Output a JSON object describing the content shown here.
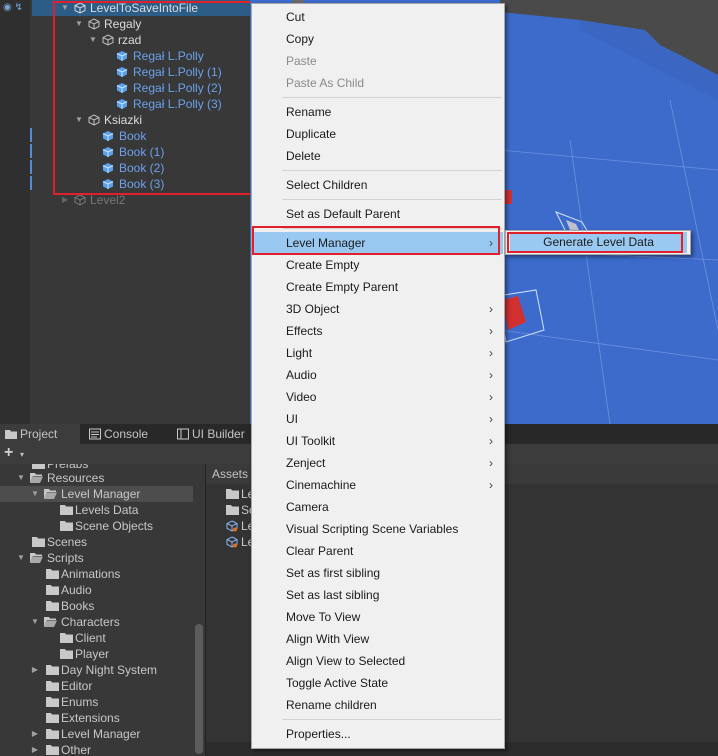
{
  "hierarchy": {
    "root": "LevelToSaveIntoFile",
    "items": [
      {
        "label": "Regaly"
      },
      {
        "label": "rzad"
      },
      {
        "label": "Regał L.Polly"
      },
      {
        "label": "Regał L.Polly (1)"
      },
      {
        "label": "Regał L.Polly (2)"
      },
      {
        "label": "Regał L.Polly (3)"
      },
      {
        "label": "Ksiazki"
      },
      {
        "label": "Book"
      },
      {
        "label": "Book (1)"
      },
      {
        "label": "Book (2)"
      },
      {
        "label": "Book (3)"
      },
      {
        "label": "Level2"
      }
    ]
  },
  "tabs": [
    {
      "label": "Project",
      "icon": "folder-icon"
    },
    {
      "label": "Console",
      "icon": "console-icon"
    },
    {
      "label": "UI Builder",
      "icon": "ui-builder-icon"
    }
  ],
  "toolbar": {
    "add_label": "+",
    "add_caret": "▾"
  },
  "project_tree": [
    {
      "label": "Prefabs"
    },
    {
      "label": "Resources"
    },
    {
      "label": "Level Manager"
    },
    {
      "label": "Levels Data"
    },
    {
      "label": "Scene Objects"
    },
    {
      "label": "Scenes"
    },
    {
      "label": "Scripts"
    },
    {
      "label": "Animations"
    },
    {
      "label": "Audio"
    },
    {
      "label": "Books"
    },
    {
      "label": "Characters"
    },
    {
      "label": "Client"
    },
    {
      "label": "Player"
    },
    {
      "label": "Day Night System"
    },
    {
      "label": "Editor"
    },
    {
      "label": "Enums"
    },
    {
      "label": "Extensions"
    },
    {
      "label": "Level Manager"
    },
    {
      "label": "Other"
    }
  ],
  "assets": {
    "header": "Assets",
    "items": [
      {
        "label": "Le"
      },
      {
        "label": "Sc"
      },
      {
        "label": "Le"
      },
      {
        "label": "Le"
      }
    ]
  },
  "context_menu": {
    "items": [
      {
        "label": "Cut"
      },
      {
        "label": "Copy"
      },
      {
        "label": "Paste"
      },
      {
        "label": "Paste As Child"
      },
      {
        "label": "Rename"
      },
      {
        "label": "Duplicate"
      },
      {
        "label": "Delete"
      },
      {
        "label": "Select Children"
      },
      {
        "label": "Set as Default Parent"
      },
      {
        "label": "Level Manager"
      },
      {
        "label": "Create Empty"
      },
      {
        "label": "Create Empty Parent"
      },
      {
        "label": "3D Object"
      },
      {
        "label": "Effects"
      },
      {
        "label": "Light"
      },
      {
        "label": "Audio"
      },
      {
        "label": "Video"
      },
      {
        "label": "UI"
      },
      {
        "label": "UI Toolkit"
      },
      {
        "label": "Zenject"
      },
      {
        "label": "Cinemachine"
      },
      {
        "label": "Camera"
      },
      {
        "label": "Visual Scripting Scene Variables"
      },
      {
        "label": "Clear Parent"
      },
      {
        "label": "Set as first sibling"
      },
      {
        "label": "Set as last sibling"
      },
      {
        "label": "Move To View"
      },
      {
        "label": "Align With View"
      },
      {
        "label": "Align View to Selected"
      },
      {
        "label": "Toggle Active State"
      },
      {
        "label": "Rename children"
      },
      {
        "label": "Properties..."
      }
    ],
    "submenu_arrow": "›",
    "submenu": {
      "label": "Generate Level Data"
    }
  },
  "colors": {
    "selection": "#2c5d87",
    "menu_highlight": "#99c9f1",
    "annotation_red": "#e0202a",
    "scene_blue": "#3c68c8",
    "prefab_blue": "#6ca0ea"
  }
}
